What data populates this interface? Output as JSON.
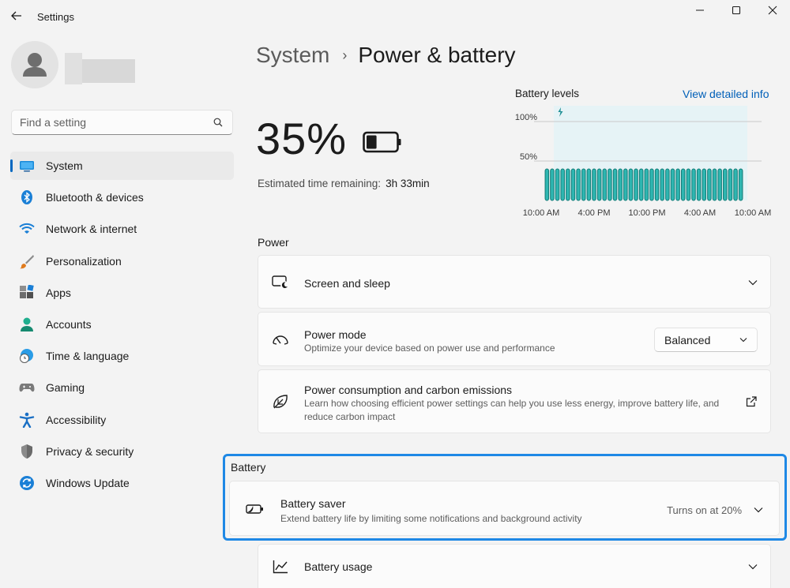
{
  "window": {
    "title": "Settings",
    "controls": [
      "minimize-icon",
      "maximize-icon",
      "close-icon"
    ]
  },
  "sidebar": {
    "search_placeholder": "Find a setting",
    "items": [
      {
        "label": "System",
        "icon": "system-icon",
        "active": true
      },
      {
        "label": "Bluetooth & devices",
        "icon": "bluetooth-icon"
      },
      {
        "label": "Network & internet",
        "icon": "wifi-icon"
      },
      {
        "label": "Personalization",
        "icon": "brush-icon"
      },
      {
        "label": "Apps",
        "icon": "apps-icon"
      },
      {
        "label": "Accounts",
        "icon": "accounts-icon"
      },
      {
        "label": "Time & language",
        "icon": "globe-clock-icon"
      },
      {
        "label": "Gaming",
        "icon": "gamepad-icon"
      },
      {
        "label": "Accessibility",
        "icon": "accessibility-icon"
      },
      {
        "label": "Privacy & security",
        "icon": "shield-icon"
      },
      {
        "label": "Windows Update",
        "icon": "update-icon"
      }
    ]
  },
  "breadcrumb": {
    "parent": "System",
    "separator": "›",
    "current": "Power & battery"
  },
  "battery_summary": {
    "percent": "35%",
    "level": 0.35,
    "estimate_label": "Estimated time remaining:",
    "estimate_value": "3h 33min"
  },
  "chart_data": {
    "type": "bar",
    "title": "Battery levels",
    "link_label": "View detailed info",
    "y_ticks": [
      "100%",
      "50%"
    ],
    "x_ticks": [
      "10:00 AM",
      "4:00 PM",
      "10:00 PM",
      "4:00 AM",
      "10:00 AM"
    ],
    "ylim": [
      0,
      100
    ],
    "values": [
      40,
      40,
      40,
      40,
      40,
      40,
      40,
      40,
      40,
      40,
      40,
      40,
      40,
      40,
      40,
      40,
      40,
      40,
      40,
      40,
      40,
      40,
      40,
      40,
      40,
      40,
      40,
      40,
      40,
      40,
      40,
      40,
      40,
      40,
      40,
      40,
      40,
      40
    ],
    "charging_marker": "lightning-icon",
    "colors": {
      "bar": "#2eb6b1",
      "bar_edge": "#137a75",
      "charging_band": "#e6f3f6",
      "marker": "#1f8f95"
    }
  },
  "power_section": {
    "title": "Power",
    "cards": [
      {
        "title": "Screen and sleep",
        "icon": "screen-sleep-icon"
      },
      {
        "title": "Power mode",
        "desc": "Optimize your device based on power use and performance",
        "icon": "speedometer-icon",
        "select_value": "Balanced"
      },
      {
        "title": "Power consumption and carbon emissions",
        "desc": "Learn how choosing efficient power settings can help you use less energy, improve battery life, and reduce carbon impact",
        "icon": "leaf-icon"
      }
    ]
  },
  "battery_section": {
    "title": "Battery",
    "saver": {
      "title": "Battery saver",
      "desc": "Extend battery life by limiting some notifications and background activity",
      "status": "Turns on at 20%",
      "icon": "battery-saver-icon"
    },
    "usage": {
      "title": "Battery usage",
      "icon": "chart-line-icon"
    }
  },
  "colors": {
    "accent": "#0067c0",
    "highlight": "#1e88e5",
    "link": "#005fb8"
  }
}
